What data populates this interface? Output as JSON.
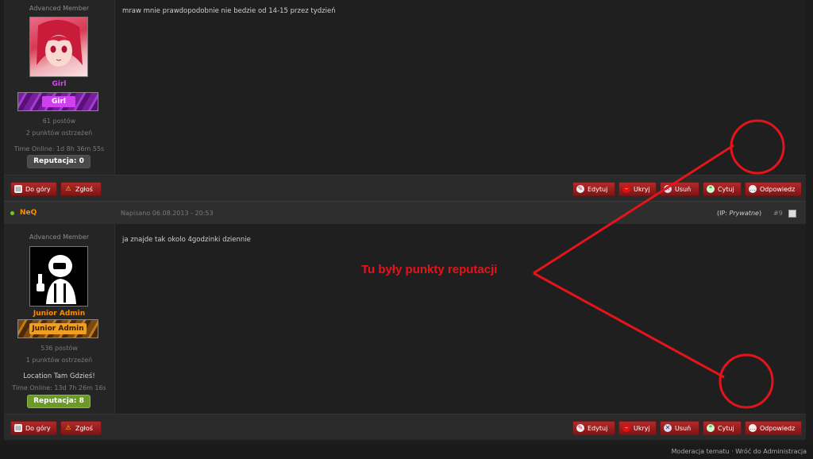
{
  "post1": {
    "rank_title": "Advanced Member",
    "username": "Girl",
    "group_badge": "Girl",
    "posts": "61 postów",
    "warnings": "2 punktów ostrzeżeń",
    "time_online": "Time Online: 1d 8h 36m 55s",
    "reputation": "Reputacja: 0",
    "text": "mraw mnie prawdopodobnie nie bedzie od 14-15 przez tydzień"
  },
  "post2": {
    "author": "NeQ",
    "date": "Napisano 06.08.2013 - 20:53",
    "ip_label": "(IP: ",
    "ip_value": "Prywatne",
    "ip_close": ")",
    "post_number": "#9",
    "rank_title": "Advanced Member",
    "username": "Junior Admin",
    "group_badge": "Junior Admin",
    "posts": "536 postów",
    "warnings": "1 punktów ostrzeżeń",
    "location": "Location Tam Gdzieś!",
    "time_online": "Time Online: 13d 7h 26m 16s",
    "reputation": "Reputacja: 8",
    "text": "ja znajde tak okolo 4godzinki dziennie"
  },
  "buttons": {
    "top": "Do góry",
    "report": "Zgłoś",
    "edit": "Edytuj",
    "hide": "Ukryj",
    "delete": "Usuń",
    "quote": "Cytuj",
    "reply": "Odpowiedz"
  },
  "annotation": {
    "text": "Tu były punkty reputacji"
  },
  "footer": {
    "moderation": "Moderacja tematu",
    "separator": " · ",
    "back": "Wróć do Administracja"
  },
  "colors": {
    "accent_red": "#e5141b",
    "username_pink": "#e040fb",
    "username_orange": "#ff8c00",
    "rep_zero": "#4a4a4a",
    "rep_positive": "#6a9a28"
  }
}
